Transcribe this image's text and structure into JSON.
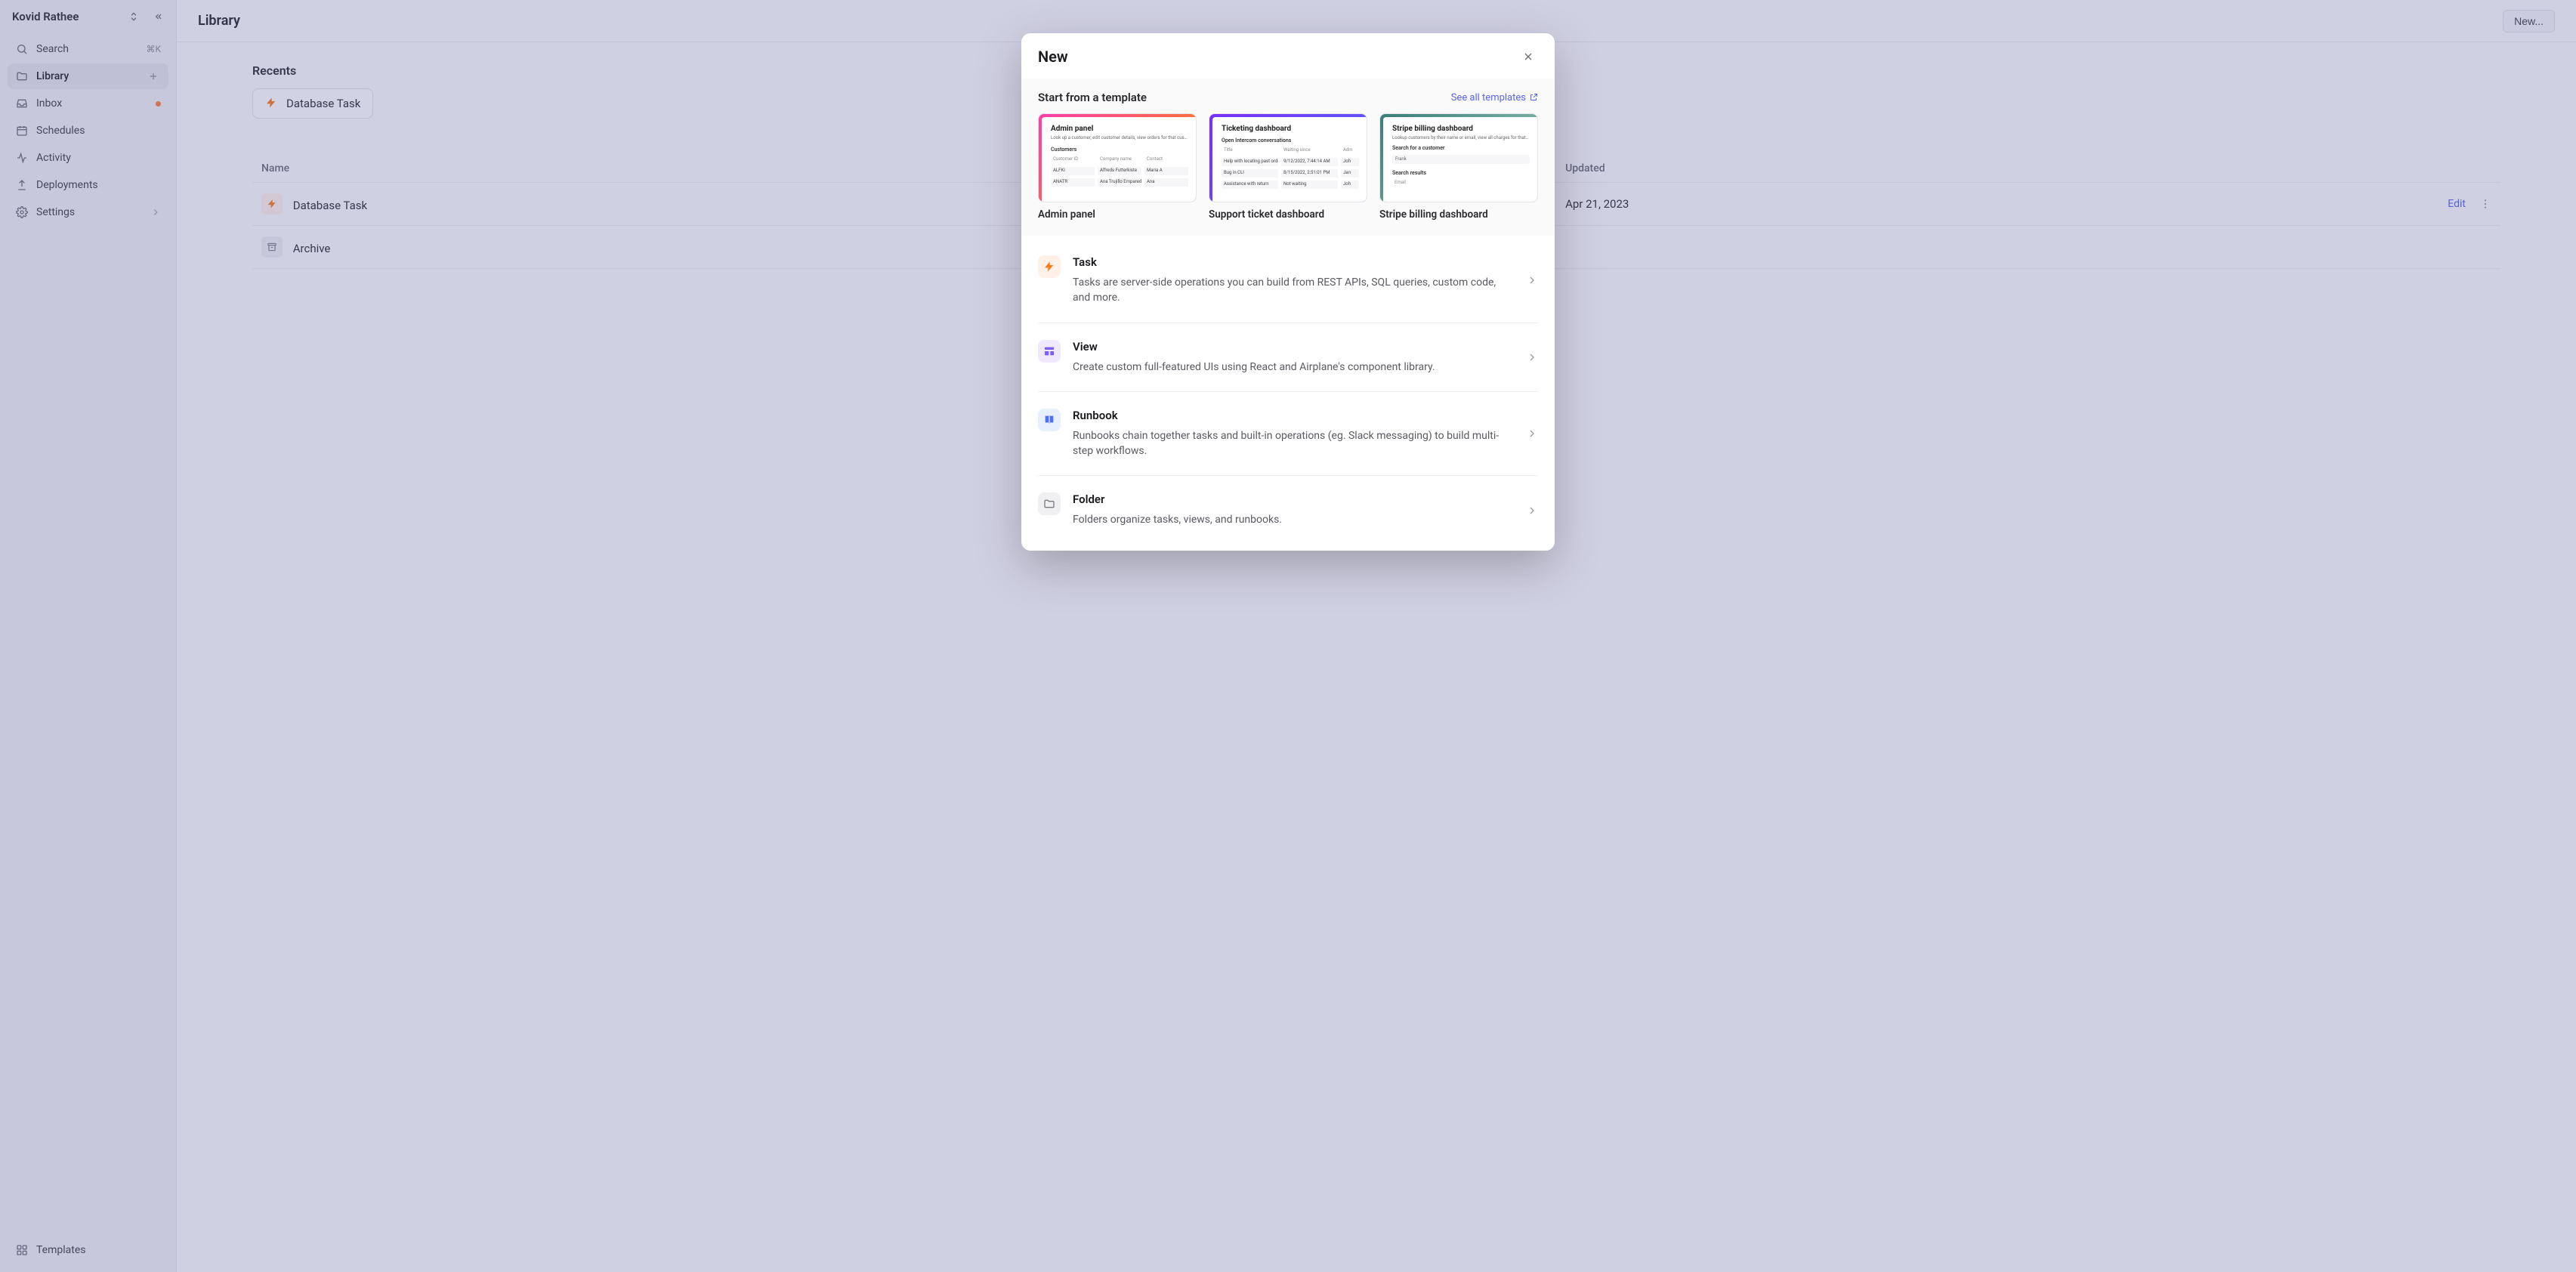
{
  "sidebar": {
    "user_name": "Kovid Rathee",
    "search": {
      "label": "Search",
      "shortcut": "⌘K"
    },
    "items": [
      {
        "key": "library",
        "label": "Library",
        "active": true
      },
      {
        "key": "inbox",
        "label": "Inbox",
        "badge": true
      },
      {
        "key": "schedules",
        "label": "Schedules"
      },
      {
        "key": "activity",
        "label": "Activity"
      },
      {
        "key": "deployments",
        "label": "Deployments"
      },
      {
        "key": "settings",
        "label": "Settings"
      }
    ],
    "footer": {
      "templates_label": "Templates"
    }
  },
  "header": {
    "title": "Library",
    "new_button": "New..."
  },
  "recents": {
    "title": "Recents",
    "items": [
      {
        "label": "Database Task"
      }
    ]
  },
  "table": {
    "columns": {
      "name": "Name",
      "updated": "Updated"
    },
    "rows": [
      {
        "kind": "task",
        "name": "Database Task",
        "updated": "Apr 21, 2023",
        "edit_label": "Edit"
      },
      {
        "kind": "folder",
        "name": "Archive"
      }
    ]
  },
  "modal": {
    "title": "New",
    "templates": {
      "heading": "Start from a template",
      "see_all": "See all templates",
      "cards": [
        {
          "label": "Admin panel",
          "title": "Admin panel",
          "subtitle": "Look up a customer, edit customer details, view orders for that customer, and e",
          "section": "Customers",
          "cols": [
            "Customer ID",
            "Company name",
            "Contact"
          ],
          "rows": [
            [
              "ALFKI",
              "Alfreds Futterkiste",
              "Maria A"
            ],
            [
              "ANATR",
              "Ana Trujillo Emparedados y",
              "Ana"
            ]
          ]
        },
        {
          "label": "Support ticket dashboard",
          "title": "Ticketing dashboard",
          "subtitle": "Open Intercom conversations",
          "cols": [
            "Title",
            "Waiting since",
            "Adm"
          ],
          "rows": [
            [
              "Help with locating past order",
              "9/12/2022, 7:44:14 AM",
              "Joh"
            ],
            [
              "Bug in CLI",
              "8/15/2022, 2:51:01 PM",
              "Jan"
            ],
            [
              "Assistance with return",
              "Not waiting",
              "Joh"
            ]
          ]
        },
        {
          "label": "Stripe billing dashboard",
          "title": "Stripe billing dashboard",
          "subtitle": "Lookup customers by their name or email, view all charges for that customer, an",
          "search_label": "Search for a customer",
          "search_value": "Frank",
          "results_label": "Search results",
          "cols": [
            "Email"
          ]
        }
      ]
    },
    "options": [
      {
        "key": "task",
        "title": "Task",
        "desc": "Tasks are server-side operations you can build from REST APIs, SQL queries, custom code, and more."
      },
      {
        "key": "view",
        "title": "View",
        "desc": "Create custom full-featured UIs using React and Airplane's component library."
      },
      {
        "key": "runbook",
        "title": "Runbook",
        "desc": "Runbooks chain together tasks and built-in operations (eg. Slack messaging) to build multi-step workflows."
      },
      {
        "key": "folder",
        "title": "Folder",
        "desc": "Folders organize tasks, views, and runbooks."
      }
    ]
  }
}
